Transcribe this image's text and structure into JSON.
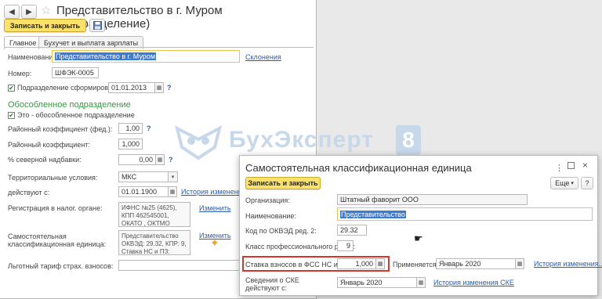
{
  "main_window": {
    "title": "Представительство в г. Муром (Подразделение)",
    "save_close": "Записать и закрыть",
    "tabs": [
      "Главное",
      "Бухучет и выплата зарплаты"
    ],
    "fields": {
      "name_label": "Наименование:",
      "name_value": "Представительство в г. Муром",
      "inflections_link": "Склонения",
      "number_label": "Номер:",
      "number_value": "ШФЭК-0005",
      "formed_label": "Подразделение сформировано",
      "formed_date": "01.01.2013",
      "section_title": "Обособленное подразделение",
      "separate_label": "Это - обособленное подразделение",
      "district_coef_fed_label": "Районный коэффициент (фед.):",
      "district_coef_fed_value": "1,00",
      "district_coef_label": "Районный коэффициент:",
      "district_coef_value": "1,000",
      "north_bonus_label": "% северной надбавки:",
      "north_bonus_value": "0,00",
      "territorial_label": "Территориальные условия:",
      "territorial_value": "МКС",
      "valid_from_label": "действуют с:",
      "valid_from_value": "01.01.1900",
      "history_link": "История изменения",
      "tax_reg_label": "Регистрация в налог. органе:",
      "tax_reg_value": "ИФНС №25 (4625), КПП 462545001, ОКАТО , ОКТМО",
      "change_link": "Изменить",
      "ske_label_1": "Самостоятельная",
      "ske_label_2": "классификационная единица:",
      "ske_value": "Представительство ОКВЭД: 29.32, КПР: 9, Ставка НС и ПЗ:",
      "change_link2": "Изменить",
      "tariff_label": "Льготный тариф страх. взносов:"
    }
  },
  "watermark": {
    "text": "БухЭксперт",
    "number": "8"
  },
  "dialog": {
    "title": "Самостоятельная классификационная единица",
    "save_close": "Записать и закрыть",
    "more_button": "Еще",
    "help_button": "?",
    "org_label": "Организация:",
    "org_value": "Штатный фаворит ООО",
    "name_label": "Наименование:",
    "name_value": "Представительство",
    "okved_label": "Код по ОКВЭД ред. 2:",
    "okved_value": "29.32",
    "risk_label": "Класс профессионального риска:",
    "risk_value": "9",
    "rate_label": "Ставка взносов в ФСС НС и ПЗ:",
    "rate_value": "1,000",
    "applied_label": "Применяется с:",
    "applied_value": "Январь 2020",
    "history_link": "История изменения...",
    "ske_info_label_1": "Сведения о СКЕ",
    "ske_info_label_2": "действуют с:",
    "ske_info_value": "Январь 2020",
    "ske_history_link": "История изменения СКЕ"
  },
  "colors": {
    "accent_yellow": "#fce26a",
    "highlight_red": "#d9342b",
    "link_blue": "#2a5db0",
    "section_green": "#2f9d3c"
  }
}
